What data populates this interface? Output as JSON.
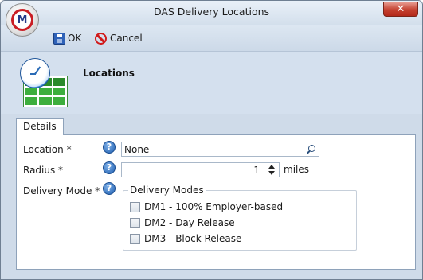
{
  "window": {
    "title": "DAS Delivery Locations",
    "close_glyph": "✕",
    "app_logo_text": "M"
  },
  "toolbar": {
    "ok_label": "OK",
    "cancel_label": "Cancel"
  },
  "header": {
    "title": "Locations"
  },
  "tabs": [
    {
      "label": "Details",
      "selected": true
    }
  ],
  "form": {
    "location": {
      "label": "Location *",
      "value": "None"
    },
    "radius": {
      "label": "Radius *",
      "value": "1",
      "unit": "miles"
    },
    "delivery_mode": {
      "label": "Delivery Mode *",
      "group_title": "Delivery Modes",
      "options": [
        {
          "label": "DM1 - 100% Employer-based",
          "checked": false
        },
        {
          "label": "DM2 - Day Release",
          "checked": false
        },
        {
          "label": "DM3 - Block Release",
          "checked": false
        }
      ]
    },
    "help_glyph": "?"
  },
  "colors": {
    "window_bg": "#cfdbe9",
    "close_red": "#c4402f",
    "help_blue": "#1f5fb0",
    "cancel_red": "#d11a1a",
    "grid_green": "#3dae3d"
  }
}
